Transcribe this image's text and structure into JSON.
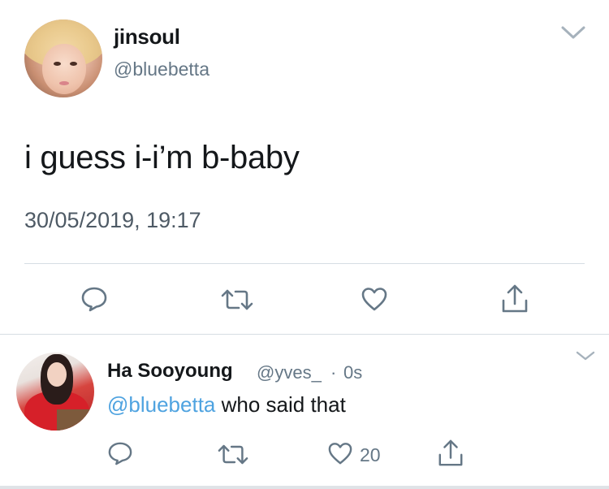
{
  "main_tweet": {
    "display_name": "jinsoul",
    "handle": "@bluebetta",
    "text": "i guess i-i’m b-baby",
    "timestamp": "30/05/2019, 19:17",
    "actions": [
      {
        "name": "reply",
        "icon": "speech-bubble-icon"
      },
      {
        "name": "retweet",
        "icon": "retweet-icon"
      },
      {
        "name": "like",
        "icon": "heart-icon"
      },
      {
        "name": "share",
        "icon": "share-icon"
      }
    ]
  },
  "reply_tweet": {
    "display_name": "Ha Sooyoung",
    "handle": "@yves_",
    "separator": "·",
    "time": "0s",
    "mention": "@bluebetta",
    "text": " who said that",
    "like_count": "20"
  },
  "colors": {
    "text": "#14171a",
    "secondary_text": "#657786",
    "mention": "#4fa3e0",
    "divider": "#d6dde3",
    "icon": "#657786"
  }
}
